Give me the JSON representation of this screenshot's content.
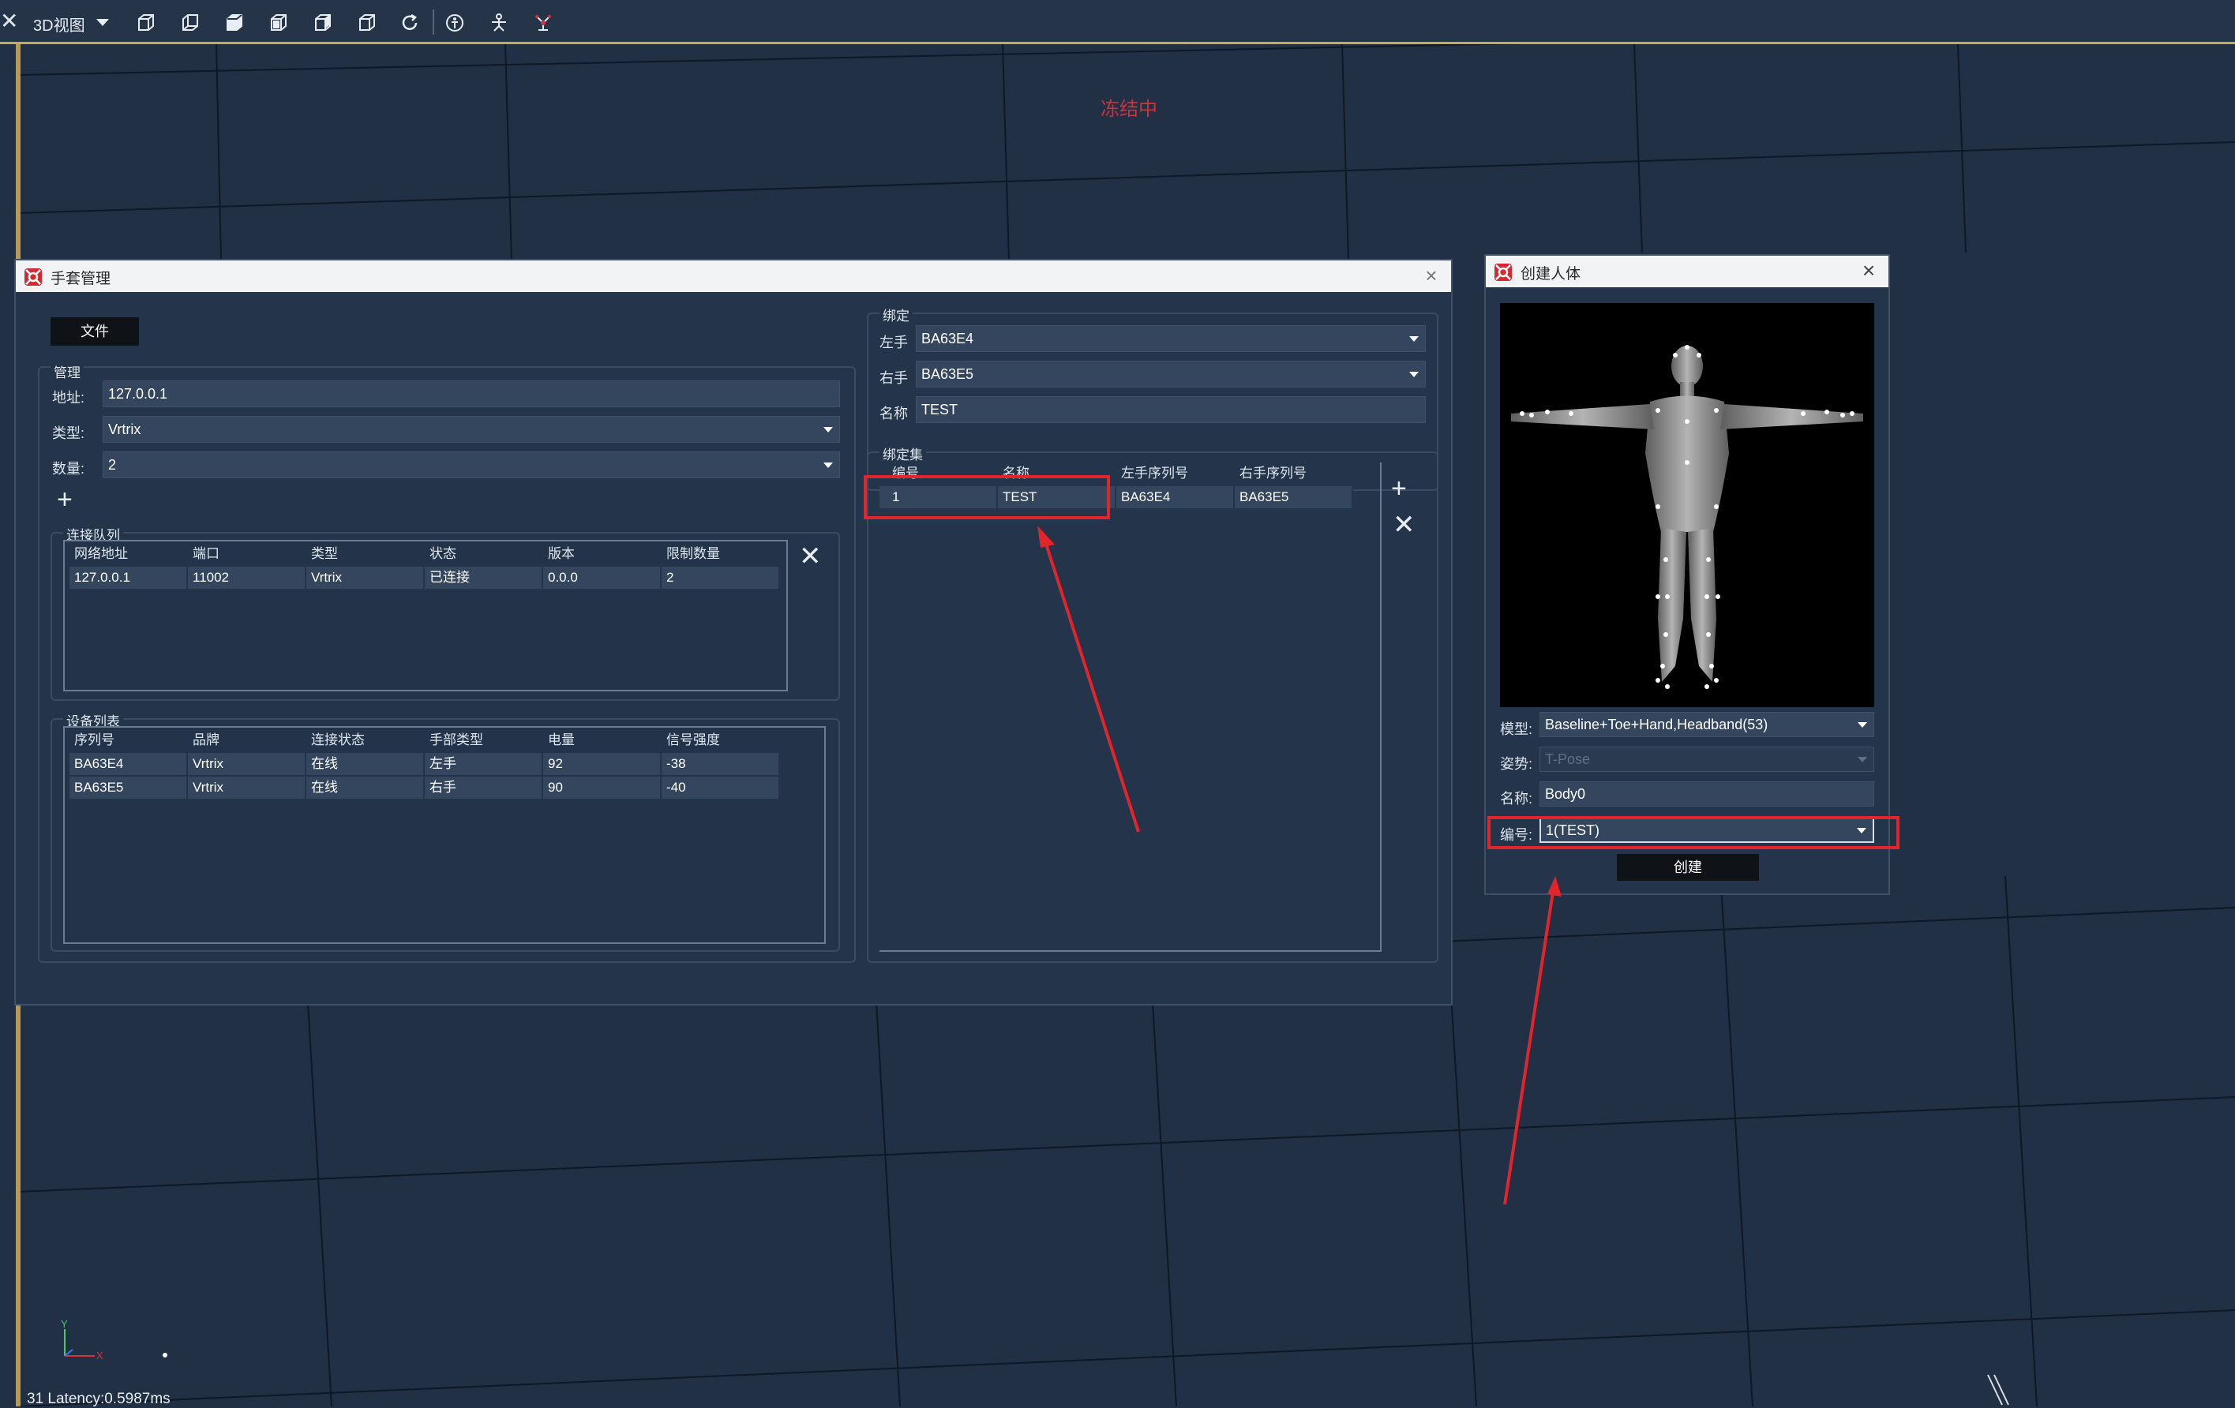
{
  "toolbar": {
    "view_label": "3D视图"
  },
  "viewport": {
    "freeze_text": "冻结中",
    "status": "31 Latency:0.5987ms",
    "axis_y": "Y",
    "axis_x": "X"
  },
  "glove_dialog": {
    "title": "手套管理",
    "file_button": "文件",
    "manage": {
      "group": "管理",
      "address_label": "地址:",
      "address_value": "127.0.0.1",
      "type_label": "类型:",
      "type_value": "Vrtrix",
      "count_label": "数量:",
      "count_value": "2"
    },
    "queue": {
      "group": "连接队列",
      "headers": [
        "网络地址",
        "端口",
        "类型",
        "状态",
        "版本",
        "限制数量"
      ],
      "rows": [
        [
          "127.0.0.1",
          "11002",
          "Vrtrix",
          "已连接",
          "0.0.0",
          "2"
        ]
      ]
    },
    "devices": {
      "group": "设备列表",
      "headers": [
        "序列号",
        "品牌",
        "连接状态",
        "手部类型",
        "电量",
        "信号强度"
      ],
      "rows": [
        [
          "BA63E4",
          "Vrtrix",
          "在线",
          "左手",
          "92",
          "-38"
        ],
        [
          "BA63E5",
          "Vrtrix",
          "在线",
          "右手",
          "90",
          "-40"
        ]
      ]
    },
    "binding": {
      "group": "绑定",
      "left_label": "左手",
      "left_value": "BA63E4",
      "right_label": "右手",
      "right_value": "BA63E5",
      "name_label": "名称",
      "name_value": "TEST"
    },
    "binding_set": {
      "group": "绑定集",
      "headers": [
        "编号",
        "名称",
        "左手序列号",
        "右手序列号"
      ],
      "rows": [
        [
          "1",
          "TEST",
          "BA63E4",
          "BA63E5"
        ]
      ]
    }
  },
  "body_dialog": {
    "title": "创建人体",
    "model_label": "模型:",
    "model_value": "Baseline+Toe+Hand,Headband(53)",
    "pose_label": "姿势:",
    "pose_value": "T-Pose",
    "name_label": "名称:",
    "name_value": "Body0",
    "number_label": "编号:",
    "number_value": "1(TEST)",
    "create_button": "创建"
  },
  "colors": {
    "background": "#213044",
    "highlight": "#e2242b",
    "dialog": "#24344a",
    "field": "#34465d"
  }
}
